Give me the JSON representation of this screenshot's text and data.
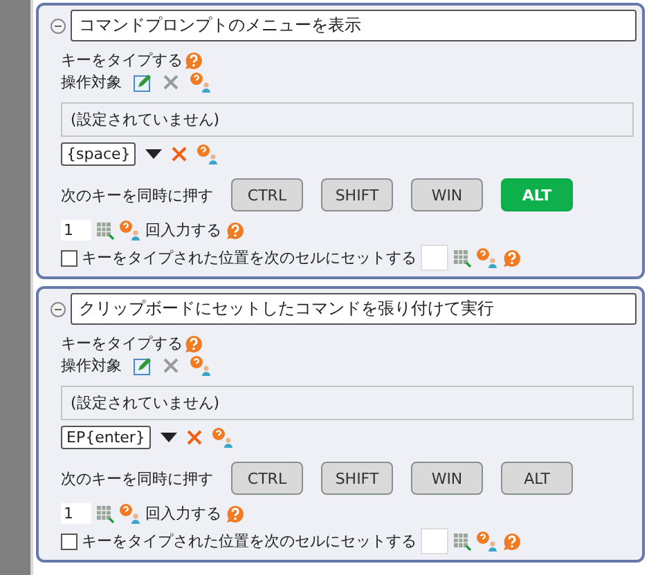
{
  "actions": [
    {
      "title": "コマンドプロンプトのメニューを表示",
      "expanded": true,
      "type_label": "キーをタイプする",
      "target_label": "操作対象",
      "target_value": "(設定されていません)",
      "key_value": "{space}",
      "modifier_label": "次のキーを同時に押す",
      "modifiers": [
        {
          "label": "CTRL",
          "selected": false
        },
        {
          "label": "SHIFT",
          "selected": false
        },
        {
          "label": "WIN",
          "selected": false
        },
        {
          "label": "ALT",
          "selected": true
        }
      ],
      "count": "1",
      "count_label": "回入力する",
      "set_cell": {
        "label": "キーをタイプされた位置を次のセルにセットする",
        "checked": false
      }
    },
    {
      "title": "クリップボードにセットしたコマンドを張り付けて実行",
      "expanded": true,
      "type_label": "キーをタイプする",
      "target_label": "操作対象",
      "target_value": "(設定されていません)",
      "key_value": "EP{enter}",
      "modifier_label": "次のキーを同時に押す",
      "modifiers": [
        {
          "label": "CTRL",
          "selected": false
        },
        {
          "label": "SHIFT",
          "selected": false
        },
        {
          "label": "WIN",
          "selected": false
        },
        {
          "label": "ALT",
          "selected": false
        }
      ],
      "count": "1",
      "count_label": "回入力する",
      "set_cell": {
        "label": "キーをタイプされた位置を次のセルにセットする",
        "checked": false
      }
    }
  ]
}
